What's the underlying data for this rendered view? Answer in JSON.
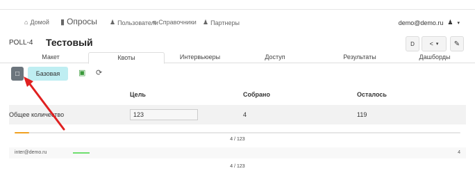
{
  "nav": {
    "home_label": "Домой",
    "polls_label": "Опросы",
    "users_label": "Пользователи",
    "refs_label": "Справочники",
    "partners_label": "Партнеры",
    "user_email": "demo@demo.ru"
  },
  "poll": {
    "id": "POLL-4",
    "name": "Тестовый",
    "btn_d_label": "D"
  },
  "tabs": [
    "Макет",
    "Квоты",
    "Интервьюеры",
    "Доступ",
    "Результаты",
    "Дашборды"
  ],
  "active_tab": "Квоты",
  "toolbar": {
    "base_label": "Базовая"
  },
  "table": {
    "col_goal": "Цель",
    "col_collected": "Собрано",
    "col_left": "Осталось",
    "total_label": "Общее количество",
    "goal_value": "123",
    "collected_value": "4",
    "left_value": "119",
    "progress_fraction": 0.0325,
    "progress_text": "4 / 123"
  },
  "interviewer": {
    "email": "inter@demo.ru",
    "count": "4",
    "progress_fraction": 0.0325,
    "progress_text": "4 / 123"
  },
  "colors": {
    "accent_tab": "#bfeef2",
    "lock_button": "#6c757d",
    "progress_orange": "#f0a020",
    "progress_green": "#6ede6e",
    "arrow": "#e02020"
  }
}
